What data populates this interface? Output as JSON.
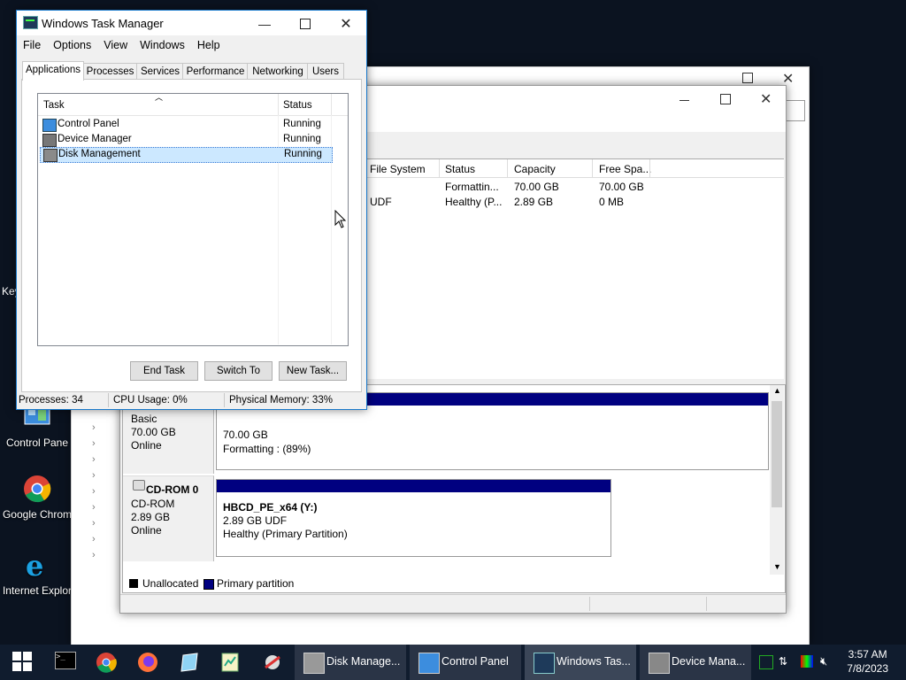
{
  "desktop": {
    "icons": [
      {
        "label": "Control Pane"
      },
      {
        "label": "Google Chrom"
      },
      {
        "label": "Internet Explor"
      }
    ],
    "partial_left_label": "Key"
  },
  "task_manager": {
    "title": "Windows Task Manager",
    "menu": [
      "File",
      "Options",
      "View",
      "Windows",
      "Help"
    ],
    "tabs": [
      "Applications",
      "Processes",
      "Services",
      "Performance",
      "Networking",
      "Users"
    ],
    "active_tab": "Applications",
    "columns": {
      "task": "Task",
      "status": "Status"
    },
    "rows": [
      {
        "task": "Control Panel",
        "status": "Running",
        "selected": false
      },
      {
        "task": "Device Manager",
        "status": "Running",
        "selected": false
      },
      {
        "task": "Disk Management",
        "status": "Running",
        "selected": true
      }
    ],
    "buttons": {
      "end_task": "End Task",
      "switch_to": "Switch To",
      "new_task": "New Task..."
    },
    "status_bar": {
      "processes": "Processes: 34",
      "cpu": "CPU Usage: 0%",
      "memory": "Physical Memory: 33%"
    }
  },
  "disk_management": {
    "columns": [
      "File System",
      "Status",
      "Capacity",
      "Free Spa..."
    ],
    "volumes": [
      {
        "fs": "",
        "status": "Formattin...",
        "capacity": "70.00 GB",
        "free": "70.00 GB"
      },
      {
        "fs": "UDF",
        "status": "Healthy (P...",
        "capacity": "2.89 GB",
        "free": "0 MB"
      }
    ],
    "disks": [
      {
        "type": "Basic",
        "size": "70.00 GB",
        "state": "Online",
        "part_size": "70.00 GB",
        "part_status": "Formatting : (89%)"
      },
      {
        "name": "CD-ROM 0",
        "type": "CD-ROM",
        "size": "2.89 GB",
        "state": "Online",
        "part_name": "HBCD_PE_x64  (Y:)",
        "part_size": "2.89 GB UDF",
        "part_status": "Healthy (Primary Partition)"
      }
    ],
    "legend": {
      "unallocated": "Unallocated",
      "primary": "Primary partition"
    }
  },
  "taskbar": {
    "apps": [
      {
        "label": "Disk Manage...",
        "active": false
      },
      {
        "label": "Control Panel",
        "active": false
      },
      {
        "label": "Windows Tas...",
        "active": true
      },
      {
        "label": "Device Mana...",
        "active": false
      }
    ],
    "time": "3:57 AM",
    "date": "7/8/2023"
  },
  "colors": {
    "accent": "#1979ca",
    "partition_primary": "#000080",
    "selection": "#cce8ff"
  }
}
